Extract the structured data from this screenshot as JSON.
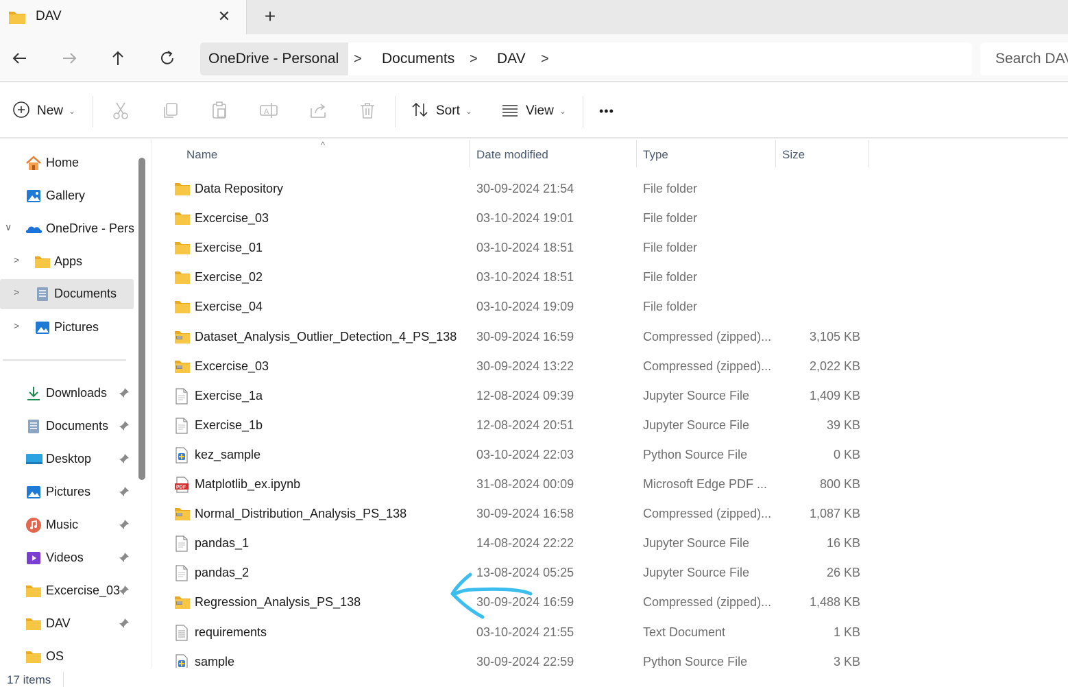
{
  "tab": {
    "title": "DAV",
    "close_glyph": "✕",
    "new_tab_glyph": "+"
  },
  "nav": {
    "back": "←",
    "forward": "→",
    "up": "↑",
    "refresh": "↻"
  },
  "breadcrumb": {
    "segments": [
      "OneDrive - Personal",
      "Documents",
      "DAV"
    ],
    "separator": ">"
  },
  "search": {
    "placeholder": "Search DAV"
  },
  "toolbar": {
    "new_label": "New",
    "sort_label": "Sort",
    "view_label": "View",
    "more_label": "•••",
    "icons": [
      "cut-icon",
      "copy-icon",
      "paste-icon",
      "rename-icon",
      "share-icon",
      "delete-icon"
    ]
  },
  "sidebar": {
    "top_items": [
      {
        "label": "Home",
        "icon": "home-icon"
      },
      {
        "label": "Gallery",
        "icon": "gallery-icon"
      },
      {
        "label": "OneDrive - Personal",
        "icon": "onedrive-icon",
        "expanded": true
      },
      {
        "label": "Apps",
        "icon": "folder-icon"
      },
      {
        "label": "Documents",
        "icon": "documents-icon",
        "selected": true
      },
      {
        "label": "Pictures",
        "icon": "pictures-icon"
      }
    ],
    "quick_access": [
      {
        "label": "Downloads",
        "icon": "downloads-icon"
      },
      {
        "label": "Documents",
        "icon": "documents-icon"
      },
      {
        "label": "Desktop",
        "icon": "desktop-icon"
      },
      {
        "label": "Pictures",
        "icon": "pictures-icon"
      },
      {
        "label": "Music",
        "icon": "music-icon"
      },
      {
        "label": "Videos",
        "icon": "videos-icon"
      },
      {
        "label": "Excercise_03",
        "icon": "folder-icon"
      },
      {
        "label": "DAV",
        "icon": "folder-icon"
      },
      {
        "label": "OS",
        "icon": "folder-icon"
      }
    ]
  },
  "columns": {
    "name": "Name",
    "date": "Date modified",
    "type": "Type",
    "size": "Size"
  },
  "files": [
    {
      "name": "Data Repository",
      "date": "30-09-2024 21:54",
      "type": "File folder",
      "size": "",
      "kind": "folder"
    },
    {
      "name": "Excercise_03",
      "date": "03-10-2024 19:01",
      "type": "File folder",
      "size": "",
      "kind": "folder"
    },
    {
      "name": "Exercise_01",
      "date": "03-10-2024 18:51",
      "type": "File folder",
      "size": "",
      "kind": "folder"
    },
    {
      "name": "Exercise_02",
      "date": "03-10-2024 18:51",
      "type": "File folder",
      "size": "",
      "kind": "folder"
    },
    {
      "name": "Exercise_04",
      "date": "03-10-2024 19:09",
      "type": "File folder",
      "size": "",
      "kind": "folder"
    },
    {
      "name": "Dataset_Analysis_Outlier_Detection_4_PS_138",
      "date": "30-09-2024 16:59",
      "type": "Compressed (zipped)...",
      "size": "3,105 KB",
      "kind": "zip"
    },
    {
      "name": "Excercise_03",
      "date": "30-09-2024 13:22",
      "type": "Compressed (zipped)...",
      "size": "2,022 KB",
      "kind": "zip"
    },
    {
      "name": "Exercise_1a",
      "date": "12-08-2024 09:39",
      "type": "Jupyter Source File",
      "size": "1,409 KB",
      "kind": "doc"
    },
    {
      "name": "Exercise_1b",
      "date": "12-08-2024 20:51",
      "type": "Jupyter Source File",
      "size": "39 KB",
      "kind": "doc"
    },
    {
      "name": "kez_sample",
      "date": "03-10-2024 22:03",
      "type": "Python Source File",
      "size": "0 KB",
      "kind": "py"
    },
    {
      "name": "Matplotlib_ex.ipynb",
      "date": "31-08-2024 00:09",
      "type": "Microsoft Edge PDF ...",
      "size": "800 KB",
      "kind": "pdf"
    },
    {
      "name": "Normal_Distribution_Analysis_PS_138",
      "date": "30-09-2024 16:58",
      "type": "Compressed (zipped)...",
      "size": "1,087 KB",
      "kind": "zip"
    },
    {
      "name": "pandas_1",
      "date": "14-08-2024 22:22",
      "type": "Jupyter Source File",
      "size": "16 KB",
      "kind": "doc"
    },
    {
      "name": "pandas_2",
      "date": "13-08-2024 05:25",
      "type": "Jupyter Source File",
      "size": "26 KB",
      "kind": "doc"
    },
    {
      "name": "Regression_Analysis_PS_138",
      "date": "30-09-2024 16:59",
      "type": "Compressed (zipped)...",
      "size": "1,488 KB",
      "kind": "zip"
    },
    {
      "name": "requirements",
      "date": "03-10-2024 21:55",
      "type": "Text Document",
      "size": "1 KB",
      "kind": "txt"
    },
    {
      "name": "sample",
      "date": "30-09-2024 22:59",
      "type": "Python Source File",
      "size": "3 KB",
      "kind": "py"
    }
  ],
  "status": {
    "item_count": "17 items"
  },
  "colors": {
    "folder": "#f6c644",
    "accent": "#0067c0",
    "annotation": "#3bbdf0",
    "selected": "#e5e5e5"
  }
}
